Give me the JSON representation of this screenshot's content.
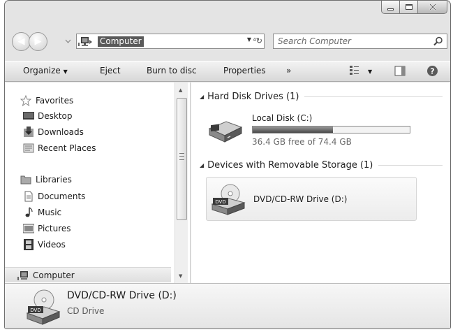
{
  "address": {
    "location": "Computer"
  },
  "search": {
    "placeholder": "Search Computer"
  },
  "toolbar": {
    "organize": "Organize",
    "eject": "Eject",
    "burn": "Burn to disc",
    "properties": "Properties",
    "more": "»"
  },
  "sidebar": {
    "favorites": {
      "label": "Favorites",
      "items": [
        {
          "label": "Desktop"
        },
        {
          "label": "Downloads"
        },
        {
          "label": "Recent Places"
        }
      ]
    },
    "libraries": {
      "label": "Libraries",
      "items": [
        {
          "label": "Documents"
        },
        {
          "label": "Music"
        },
        {
          "label": "Pictures"
        },
        {
          "label": "Videos"
        }
      ]
    },
    "computer": {
      "label": "Computer"
    }
  },
  "content": {
    "hdd_header": "Hard Disk Drives (1)",
    "local_disk": {
      "name": "Local Disk (C:)",
      "free_text": "36.4 GB free of 74.4 GB",
      "used_fraction": 0.51
    },
    "removable_header": "Devices with Removable Storage (1)",
    "dvd": {
      "name": "DVD/CD-RW Drive (D:)",
      "badge": "DVD"
    }
  },
  "details": {
    "name": "DVD/CD-RW Drive (D:)",
    "type": "CD Drive",
    "badge": "DVD"
  },
  "colors": {
    "progress_fill": "#4a4a4a",
    "selection": "#5a5a5a"
  }
}
